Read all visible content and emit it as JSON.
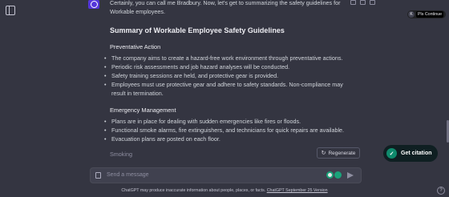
{
  "message": {
    "intro": "Certainly, you can call me Bradbury. Now, let's get to summarizing the safety guidelines for Workable employees.",
    "heading": "Summary of Workable Employee Safety Guidelines",
    "sections": [
      {
        "title": "Preventative Action",
        "items": [
          "The company aims to create a hazard-free work environment through preventative actions.",
          "Periodic risk assessments and job hazard analyses will be conducted.",
          "Safety training sessions are held, and protective gear is provided.",
          "Employees must use protective gear and adhere to safety standards. Non-compliance may result in termination."
        ]
      },
      {
        "title": "Emergency Management",
        "items": [
          "Plans are in place for dealing with sudden emergencies like fires or floods.",
          "Functional smoke alarms, fire extinguishers, and technicians for quick repairs are available.",
          "Evacuation plans are posted on each floor."
        ]
      }
    ],
    "next_section_title": "Smoking"
  },
  "continue_hint": {
    "key": "K",
    "label": "Pls Continue"
  },
  "regenerate_label": "Regenerate",
  "get_citation_label": "Get citation",
  "input": {
    "placeholder": "Send a message"
  },
  "footer": {
    "text": "ChatGPT may produce inaccurate information about people, places, or facts. ",
    "link": "ChatGPT September 25 Version"
  },
  "help_label": "?",
  "colors": {
    "background": "#343541",
    "input_bg": "#40414f",
    "citation_accent": "#0f8a6c"
  }
}
